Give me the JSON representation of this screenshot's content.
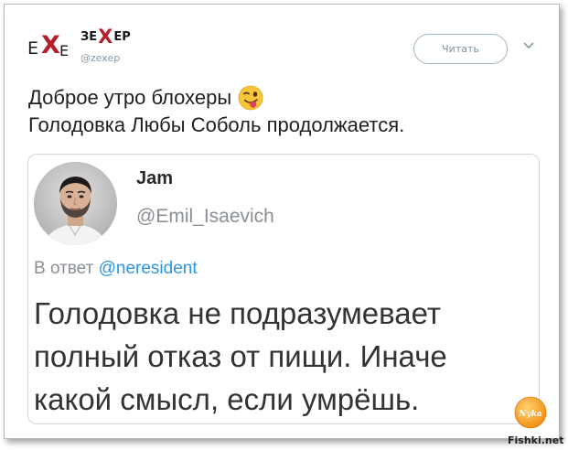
{
  "header": {
    "logo_left": "E",
    "logo_x": "X",
    "logo_right": "E",
    "name_part1": "ЗЕ",
    "name_x": "X",
    "name_part2": "ЕР",
    "handle": "@zexep",
    "follow_label": "Читать"
  },
  "tweet": {
    "line1": "Доброе утро блохеры",
    "line1_emoji": "winking-face-with-tongue",
    "line2": "Голодовка Любы Соболь продолжается."
  },
  "quote": {
    "name": "Jam",
    "handle": "@Emil_Isaevich",
    "reply_prefix": "В ответ",
    "reply_mention": "@neresident",
    "body_lines": [
      "Голодовка не подразумевает",
      "полный отказ от пищи. Иначе",
      "какой смысл, если умрёшь."
    ]
  },
  "watermark": {
    "badge_text": "Nyka",
    "site": "Fishki.net"
  },
  "colors": {
    "logo_x": "#b41f2b",
    "mention": "#2c95e6",
    "border": "#cfd8de",
    "muted": "#8a8f94"
  }
}
